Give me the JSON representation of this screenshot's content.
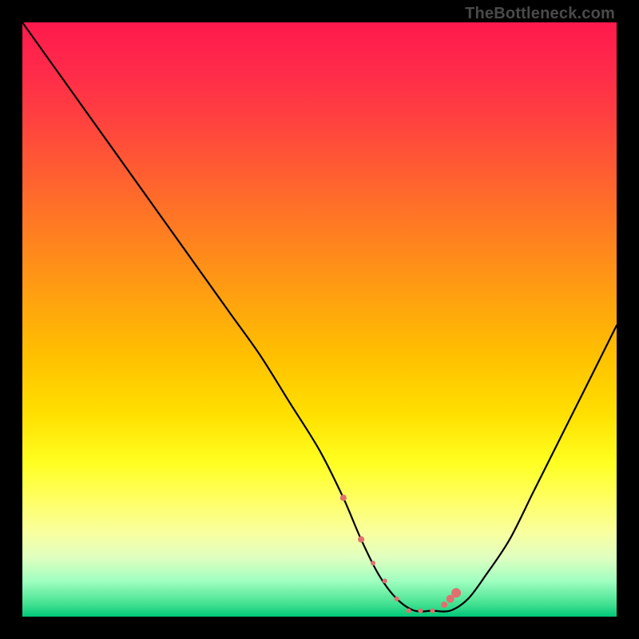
{
  "attribution": "TheBottleneck.com",
  "colors": {
    "frame_bg": "#000000",
    "gradient_top": "#ff1a4d",
    "gradient_bottom": "#00c878",
    "curve_stroke": "#000000",
    "marker_fill": "#e07070"
  },
  "chart_data": {
    "type": "line",
    "title": "",
    "xlabel": "",
    "ylabel": "",
    "xlim": [
      0,
      100
    ],
    "ylim": [
      0,
      100
    ],
    "grid": false,
    "legend": false,
    "series": [
      {
        "name": "bottleneck-curve",
        "x": [
          0,
          5,
          10,
          15,
          20,
          25,
          30,
          35,
          40,
          45,
          50,
          54,
          57,
          60,
          63,
          66,
          69,
          72,
          75,
          78,
          82,
          86,
          90,
          94,
          100
        ],
        "values": [
          100,
          93,
          86,
          79,
          72,
          65,
          58,
          51,
          44,
          36,
          28,
          20,
          13,
          7,
          3,
          1,
          1,
          1,
          3,
          7,
          13,
          21,
          29,
          37,
          49
        ]
      }
    ],
    "markers": {
      "name": "highlight-points",
      "x": [
        54,
        57,
        59,
        61,
        63,
        65,
        67,
        69,
        71,
        72,
        73
      ],
      "values": [
        20,
        13,
        9,
        6,
        3,
        1,
        1,
        1,
        2,
        3,
        4
      ],
      "size": [
        4,
        4,
        3,
        3,
        3,
        3,
        3,
        3,
        4,
        5,
        6
      ]
    }
  }
}
